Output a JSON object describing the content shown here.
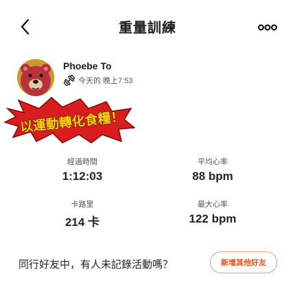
{
  "header": {
    "title": "重量訓練"
  },
  "user": {
    "name": "Phoebe To",
    "activity_time": "今天的 晚上7:53"
  },
  "sticker": {
    "text": "以運動轉化食糧！"
  },
  "stats": [
    {
      "label": "經過時間",
      "value": "1:12:03"
    },
    {
      "label": "平均心率",
      "value": "88 bpm"
    },
    {
      "label": "卡路里",
      "value": "214 卡"
    },
    {
      "label": "最大心率",
      "value": "122 bpm"
    }
  ],
  "footer": {
    "prompt": "同行好友中，有人未記錄活動嗎？",
    "add_button": "新增其他好友"
  },
  "colors": {
    "accent": "#e0561e",
    "sticker_red": "#d91c1c",
    "sticker_text": "#ffd400"
  }
}
